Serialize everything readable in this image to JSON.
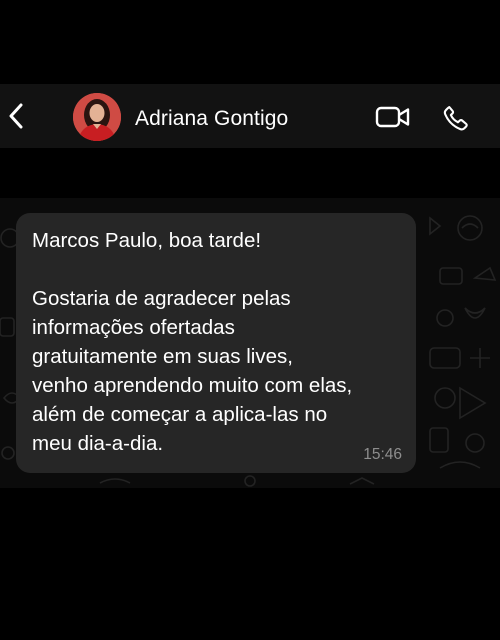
{
  "header": {
    "contact_name": "Adriana Gontigo",
    "icons": {
      "back": "chevron-left-icon",
      "avatar": "avatar",
      "video": "video-camera-icon",
      "call": "phone-icon"
    }
  },
  "colors": {
    "header_bg": "#121212",
    "chat_bg": "#0b0b0b",
    "bubble_bg": "#262626",
    "text": "#ffffff",
    "timestamp": "#8e8e8e"
  },
  "message": {
    "greeting": "Marcos Paulo, boa tarde!",
    "lines": [
      "Gostaria de agradecer pelas",
      "informações ofertadas",
      "gratuitamente em suas lives,",
      "venho aprendendo muito com elas,",
      "além de começar a aplica-las no",
      "meu dia-a-dia."
    ],
    "time": "15:46"
  }
}
